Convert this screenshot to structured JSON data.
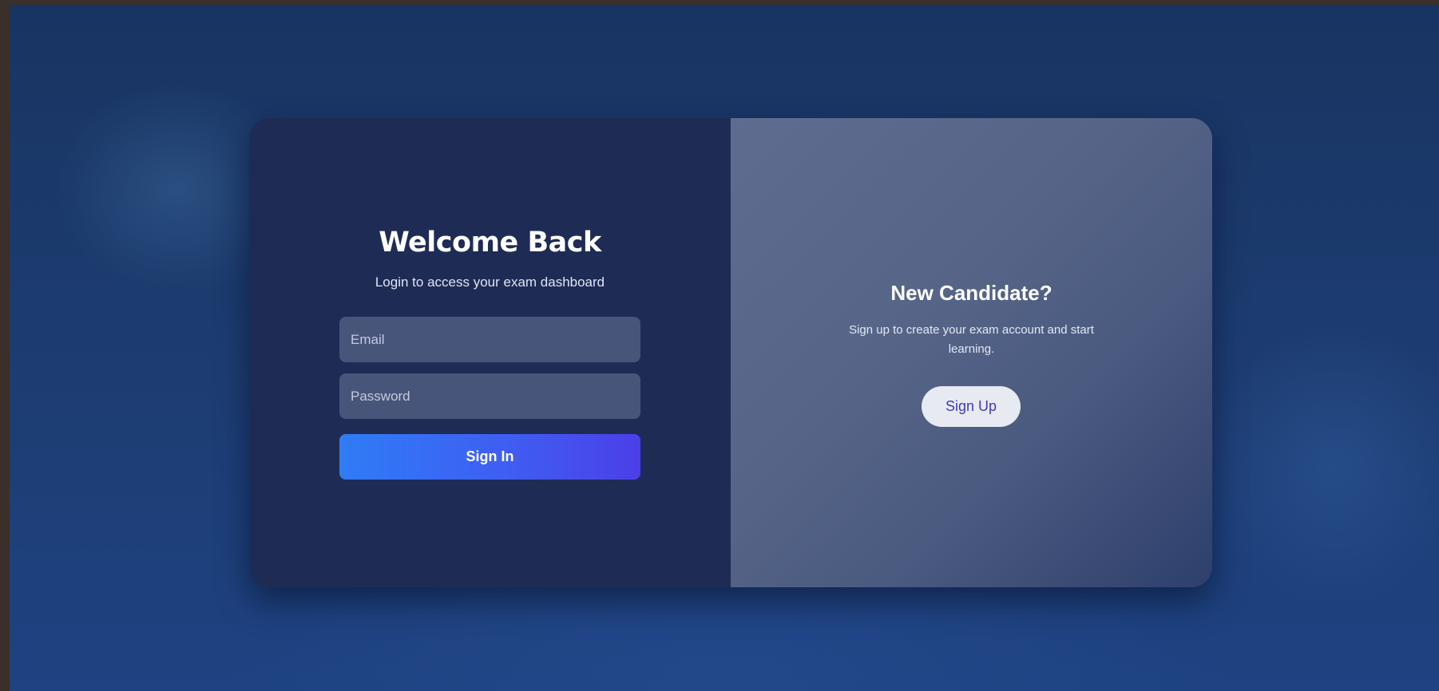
{
  "login": {
    "title": "Welcome Back",
    "subtitle": "Login to access your exam dashboard",
    "email_placeholder": "Email",
    "email_value": "",
    "password_placeholder": "Password",
    "password_value": "",
    "signin_label": "Sign In"
  },
  "signup": {
    "title": "New Candidate?",
    "text": "Sign up to create your exam account and start learning.",
    "button_label": "Sign Up"
  },
  "colors": {
    "background": "#1b3a6c",
    "login_panel": "#1e2c55",
    "signup_panel": "#566587",
    "input_bg": "#48557a",
    "signin_gradient_start": "#2f7cf6",
    "signin_gradient_end": "#4b3fe8",
    "signup_button_bg": "#e8eaf2",
    "signup_button_text": "#3e3ab8"
  }
}
